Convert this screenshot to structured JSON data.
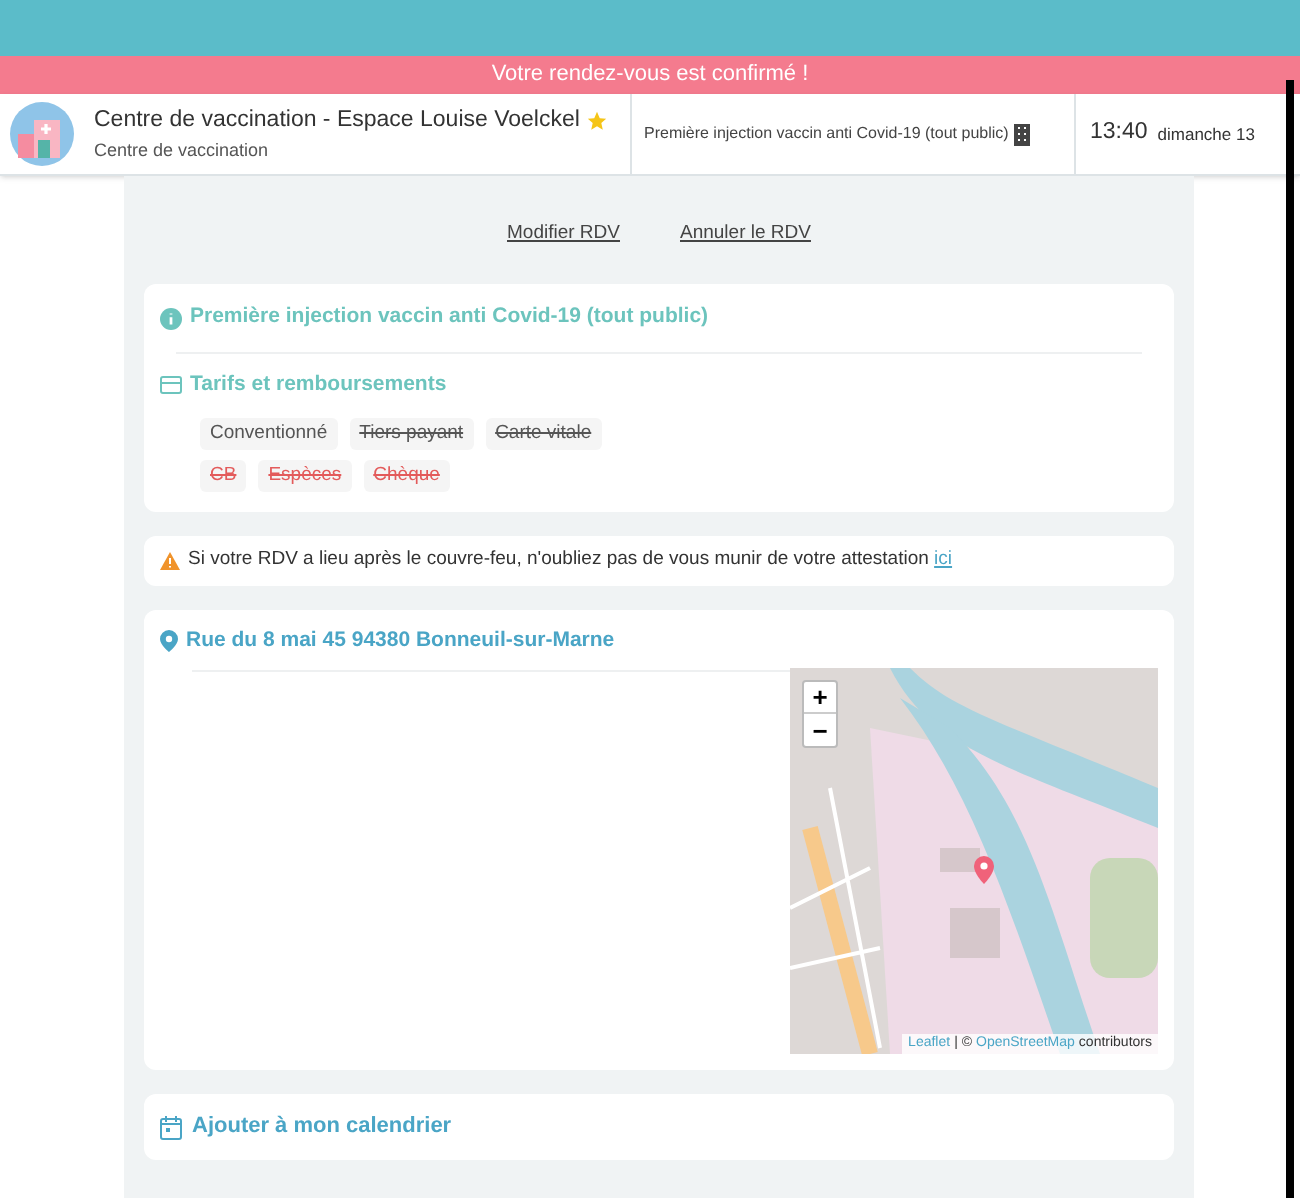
{
  "banner": {
    "text": "Votre rendez-vous est confirmé !"
  },
  "header": {
    "center_name": "Centre de vaccination - Espace Louise Voelckel",
    "favorite": true,
    "center_type": "Centre de vaccination",
    "motive": "Première injection vaccin anti Covid-19 (tout public)",
    "time": "13:40",
    "date": "dimanche 13"
  },
  "actions": [
    "Modifier RDV",
    "Annuler le RDV"
  ],
  "motive_card": {
    "title": "Première injection vaccin anti Covid-19 (tout public)",
    "pricing_title": "Tarifs et remboursements",
    "tag_rows": [
      [
        {
          "label": "Conventionné",
          "available": true,
          "kind": "coverage"
        },
        {
          "label": "Tiers payant",
          "available": false,
          "kind": "coverage"
        },
        {
          "label": "Carte vitale",
          "available": false,
          "kind": "coverage"
        }
      ],
      [
        {
          "label": "CB",
          "available": false,
          "kind": "payment"
        },
        {
          "label": "Espèces",
          "available": false,
          "kind": "payment"
        },
        {
          "label": "Chèque",
          "available": false,
          "kind": "payment"
        }
      ]
    ]
  },
  "warning": {
    "text": "Si votre RDV a lieu après le couvre-feu, n'oubliez pas de vous munir de votre attestation",
    "link": "ici"
  },
  "address_card": {
    "address": "Rue du 8 mai 45 94380 Bonneuil-sur-Marne",
    "zoom_in": "+",
    "zoom_out": "−",
    "attribution": {
      "leaflet": "Leaflet",
      "separator": "| ©",
      "osm": "OpenStreetMap",
      "suffix": "contributors"
    }
  },
  "calendar_card": {
    "title": "Ajouter à mon calendrier"
  }
}
